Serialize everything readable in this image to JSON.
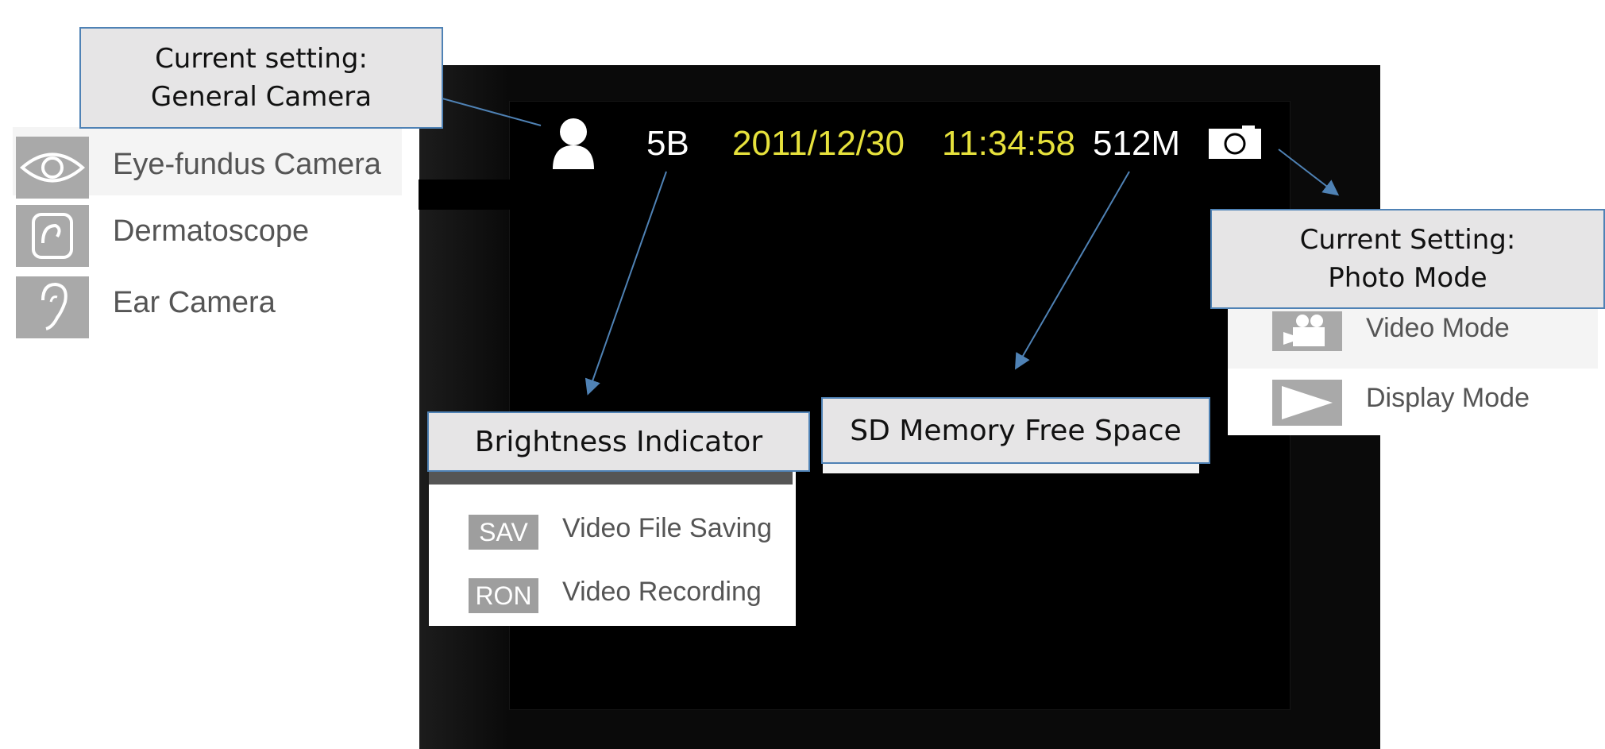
{
  "camera_modes": [
    {
      "icon": "eye-icon",
      "label": "Eye-fundus Camera"
    },
    {
      "icon": "dermatoscope-icon",
      "label": "Dermatoscope"
    },
    {
      "icon": "ear-icon",
      "label": "Ear Camera"
    }
  ],
  "status_bar": {
    "brightness": "5B",
    "date": "2011/12/30",
    "time": "11:34:58",
    "free_space": "512M",
    "user_icon": "person-icon",
    "mode_icon": "camera-icon",
    "date_color": "#e6e13c"
  },
  "capture_modes": [
    {
      "icon": "video-camera-icon",
      "label": "Video Mode"
    },
    {
      "icon": "play-icon",
      "label": "Display Mode"
    }
  ],
  "video_menu": [
    {
      "code": "SAV",
      "label": "Video File Saving"
    },
    {
      "code": "RON",
      "label": "Video Recording"
    }
  ],
  "callouts": {
    "current_camera": "Current setting:\nGeneral Camera",
    "current_mode": "Current Setting:\nPhoto Mode",
    "brightness": "Brightness Indicator",
    "memory": "SD Memory Free Space"
  },
  "colors": {
    "callout_fill": "#e6e5e6",
    "callout_border": "#4f82b5",
    "arrow": "#4f82b5",
    "screen": "#000000"
  }
}
